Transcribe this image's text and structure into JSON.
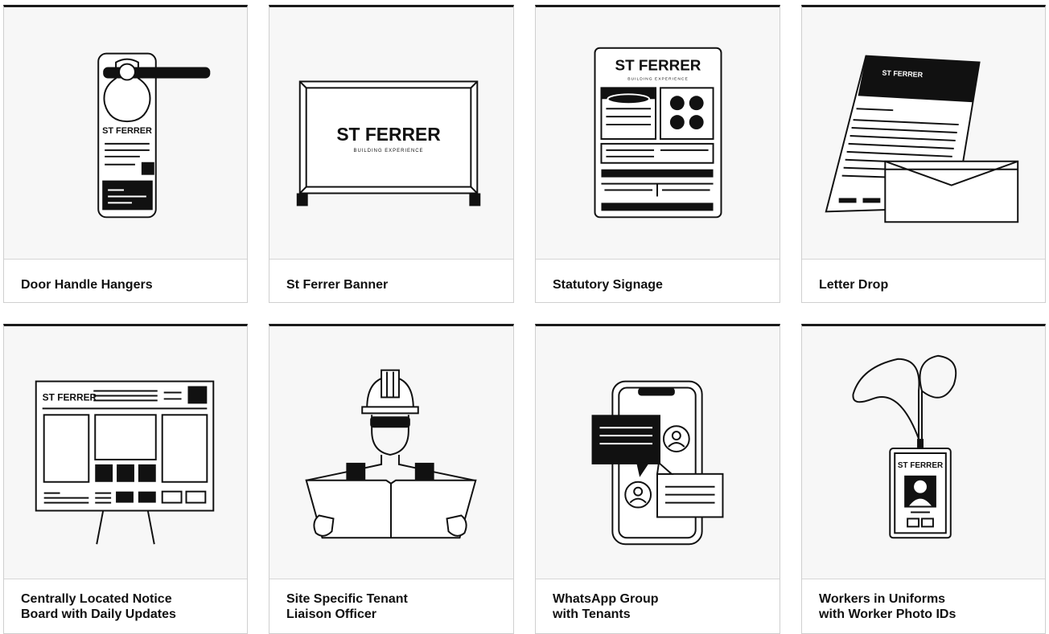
{
  "brand": {
    "logo_text": "ST FERRER",
    "logo_sub": "BUILDING EXPERIENCE"
  },
  "cards": [
    {
      "label": "Door Handle Hangers",
      "icon": "door-hanger-icon"
    },
    {
      "label": "St Ferrer Banner",
      "icon": "banner-icon"
    },
    {
      "label": "Statutory Signage",
      "icon": "signage-icon"
    },
    {
      "label": "Letter Drop",
      "icon": "letter-envelope-icon"
    },
    {
      "label": "Centrally Located Notice\nBoard with Daily Updates",
      "icon": "notice-board-icon"
    },
    {
      "label": "Site Specific Tenant\nLiaison Officer",
      "icon": "liaison-officer-icon"
    },
    {
      "label": "WhatsApp Group\nwith Tenants",
      "icon": "phone-chat-icon"
    },
    {
      "label": "Workers in Uniforms\nwith Worker Photo IDs",
      "icon": "photo-id-badge-icon"
    }
  ]
}
